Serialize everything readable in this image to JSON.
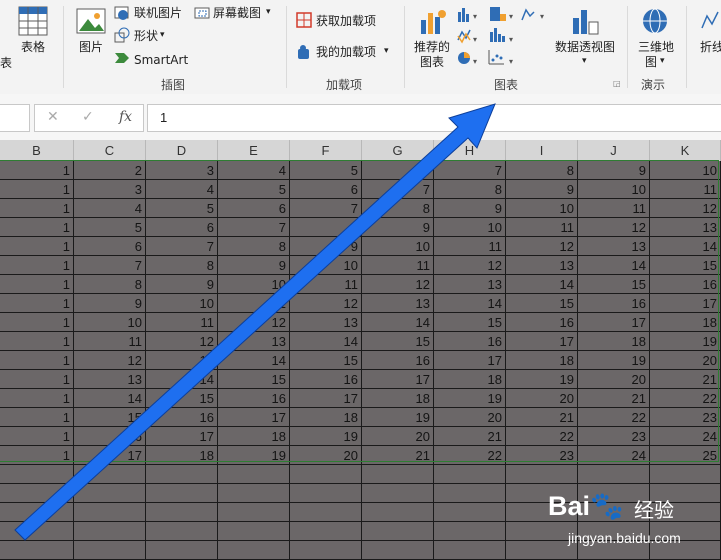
{
  "ribbon": {
    "table_partial": "表",
    "table_btn": "表格",
    "picture_btn": "图片",
    "online_picture": "联机图片",
    "screenshot": "屏幕截图",
    "shapes": "形状",
    "smartart": "SmartArt",
    "group_illustrations": "插图",
    "get_addins": "获取加载项",
    "my_addins": "我的加载项",
    "group_addins": "加载项",
    "recommended_charts_line1": "推荐的",
    "recommended_charts_line2": "图表",
    "group_charts": "图表",
    "pivot_chart": "数据透视图",
    "map_3d_line1": "三维地",
    "map_3d_line2": "图",
    "group_tours": "演示",
    "line_partial": "折线"
  },
  "formula_bar": {
    "cancel_glyph": "✕",
    "enter_glyph": "✓",
    "fx_glyph": "fx",
    "value": "1"
  },
  "columns": [
    "B",
    "C",
    "D",
    "E",
    "F",
    "G",
    "H",
    "I",
    "J",
    "K"
  ],
  "rows": [
    [
      "1",
      "2",
      "3",
      "4",
      "5",
      "6",
      "7",
      "7",
      "8",
      "9",
      "10"
    ],
    [
      "1",
      "3",
      "4",
      "5",
      "6",
      "7",
      "7",
      "8",
      "9",
      "10",
      "11"
    ],
    [
      "1",
      "4",
      "5",
      "6",
      "7",
      "8",
      "9",
      "10",
      "11",
      "12"
    ],
    [
      "1",
      "5",
      "6",
      "7",
      "8",
      "9",
      "10",
      "11",
      "12",
      "13"
    ],
    [
      "1",
      "6",
      "7",
      "8",
      "9",
      "10",
      "11",
      "12",
      "13",
      "14"
    ],
    [
      "1",
      "7",
      "8",
      "9",
      "10",
      "11",
      "12",
      "13",
      "14",
      "15"
    ],
    [
      "1",
      "8",
      "9",
      "10",
      "11",
      "12",
      "13",
      "14",
      "15",
      "16"
    ],
    [
      "1",
      "9",
      "10",
      "11",
      "12",
      "13",
      "14",
      "15",
      "16",
      "17"
    ],
    [
      "1",
      "10",
      "11",
      "12",
      "13",
      "14",
      "15",
      "16",
      "17",
      "18"
    ],
    [
      "1",
      "11",
      "12",
      "13",
      "14",
      "15",
      "16",
      "17",
      "18",
      "19"
    ],
    [
      "1",
      "12",
      "13",
      "14",
      "15",
      "16",
      "17",
      "18",
      "19",
      "20"
    ],
    [
      "1",
      "13",
      "14",
      "15",
      "16",
      "17",
      "18",
      "19",
      "20",
      "21"
    ],
    [
      "1",
      "14",
      "15",
      "16",
      "17",
      "18",
      "19",
      "20",
      "21",
      "22"
    ],
    [
      "1",
      "15",
      "16",
      "17",
      "18",
      "19",
      "20",
      "21",
      "22",
      "23"
    ],
    [
      "1",
      "16",
      "17",
      "18",
      "19",
      "20",
      "21",
      "22",
      "23",
      "24"
    ],
    [
      "1",
      "17",
      "18",
      "19",
      "20",
      "21",
      "22",
      "23",
      "24",
      "25"
    ]
  ],
  "watermark": {
    "logo": "Bai🐾",
    "cn": "经验",
    "url": "jingyan.baidu.com"
  },
  "colors": {
    "selection_fill": "#6b6768",
    "arrow": "#1e6ff0",
    "selection_border": "#2e7d32"
  }
}
